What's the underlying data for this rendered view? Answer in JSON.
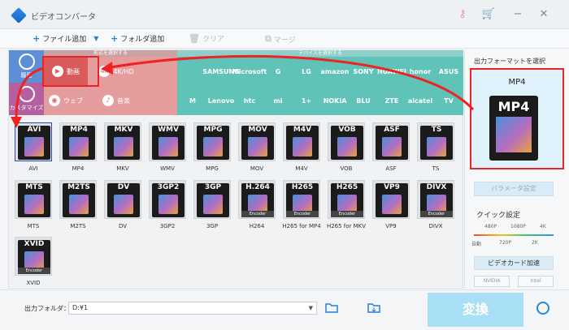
{
  "app": {
    "title": "ビデオコンバータ"
  },
  "toolbar": {
    "add_file": "ファイル追加",
    "add_folder": "フォルダ追加",
    "clear": "クリア",
    "merge": "マージ"
  },
  "sidebar": {
    "history": "履歴",
    "customize": "カスタマイズ"
  },
  "strips": {
    "category": "形式を選択する",
    "device": "デバイスを選択する"
  },
  "categories": [
    {
      "label": "動画",
      "icon": "play-icon"
    },
    {
      "label": "4K/HD",
      "icon": "4k-icon"
    },
    {
      "label": "ウェブ",
      "icon": "chrome-icon"
    },
    {
      "label": "音楽",
      "icon": "speaker-icon"
    }
  ],
  "devices": [
    [
      "",
      "SAMSUNG",
      "Microsoft",
      "G",
      "LG",
      "amazon",
      "SONY",
      "HUAWEI",
      "honor",
      "ASUS"
    ],
    [
      "M",
      "Lenovo",
      "htc",
      "mi",
      "1+",
      "NOKIA",
      "BLU",
      "ZTE",
      "alcatel",
      "TV"
    ]
  ],
  "formats_row1": [
    "AVI",
    "MP4",
    "MKV",
    "WMV",
    "MPG",
    "MOV",
    "M4V",
    "VOB",
    "ASF",
    "TS"
  ],
  "formats_row2": [
    {
      "tag": "MTS",
      "label": "MTS"
    },
    {
      "tag": "M2TS",
      "label": "M2TS"
    },
    {
      "tag": "DV",
      "label": "DV"
    },
    {
      "tag": "3GP2",
      "label": "3GP2"
    },
    {
      "tag": "3GP",
      "label": "3GP"
    },
    {
      "tag": "H.264",
      "label": "H264"
    },
    {
      "tag": "H265",
      "label": "H265 for MP4"
    },
    {
      "tag": "H265",
      "label": "H265 for MKV"
    },
    {
      "tag": "VP9",
      "label": "VP9"
    },
    {
      "tag": "DIVX",
      "label": "DIVX"
    }
  ],
  "formats_row3": [
    {
      "tag": "XVID",
      "label": "XVID"
    }
  ],
  "encoder": "Encoder",
  "right": {
    "output_label": "出力フォーマットを選択",
    "selected_format": "MP4",
    "param_button": "パラメータ設定",
    "quick_label": "クイック設定",
    "quick_top": [
      "480P",
      "1080P",
      "4K"
    ],
    "quick_bottom": [
      "自動",
      "720P",
      "2K"
    ],
    "gpu_button": "ビデオカード加速",
    "gpu_options": [
      "NVIDIA",
      "Intel"
    ]
  },
  "bottom": {
    "output_folder_label": "出力フォルダ：",
    "folder_path": "D:¥1",
    "convert": "変換"
  },
  "colors": {
    "accent": "#2a7be0",
    "highlight": "#ee2222",
    "category_bg": "#e59c9c",
    "device_bg": "#5fc3b8"
  }
}
